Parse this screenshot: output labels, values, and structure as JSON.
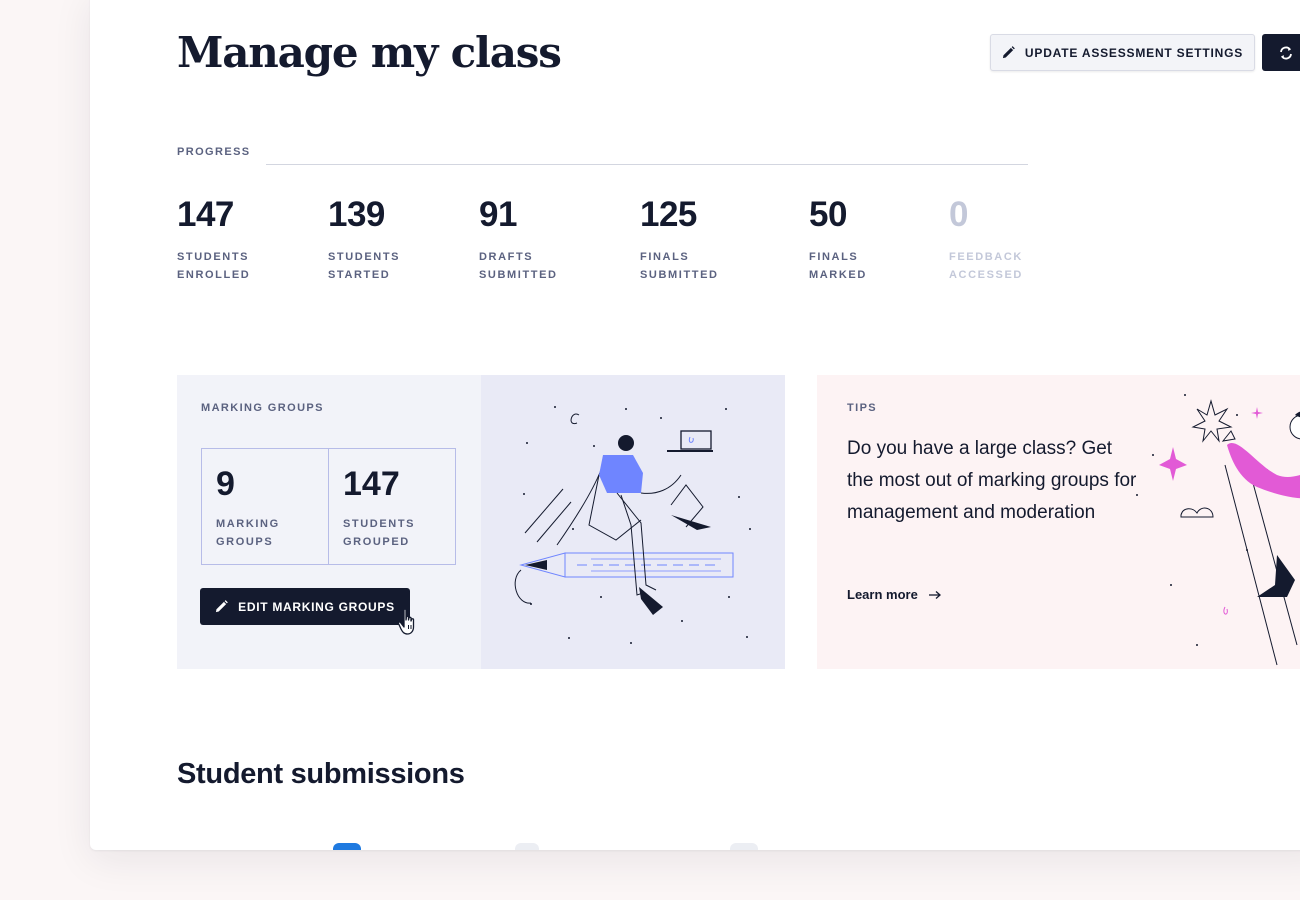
{
  "page": {
    "title": "Manage my class"
  },
  "header": {
    "settings_button": "UPDATE ASSESSMENT SETTINGS",
    "settings_icon": "pencil-icon",
    "refresh_icon": "refresh-icon"
  },
  "progress": {
    "label": "PROGRESS",
    "stats": [
      {
        "value": "147",
        "line1": "STUDENTS",
        "line2": "ENROLLED"
      },
      {
        "value": "139",
        "line1": "STUDENTS",
        "line2": "STARTED"
      },
      {
        "value": "91",
        "line1": "DRAFTS",
        "line2": "SUBMITTED"
      },
      {
        "value": "125",
        "line1": "FINALS",
        "line2": "SUBMITTED"
      },
      {
        "value": "50",
        "line1": "FINALS",
        "line2": "MARKED"
      },
      {
        "value": "0",
        "line1": "FEEDBACK",
        "line2": "ACCESSED"
      }
    ]
  },
  "marking_groups": {
    "label": "MARKING GROUPS",
    "groups_value": "9",
    "groups_line1": "MARKING",
    "groups_line2": "GROUPS",
    "students_value": "147",
    "students_line1": "STUDENTS",
    "students_line2": "GROUPED",
    "edit_button": "EDIT MARKING GROUPS"
  },
  "tips": {
    "label": "TIPS",
    "text": "Do you have a large class? Get the most out of marking groups for management and moderation",
    "link": "Learn more"
  },
  "submissions": {
    "title": "Student submissions"
  },
  "colors": {
    "navy": "#141a2e",
    "accent_blue": "#6f85ff",
    "accent_pink": "#e25ad6",
    "muted": "#c3c8d9",
    "tab_blue": "#1f7ae0"
  }
}
